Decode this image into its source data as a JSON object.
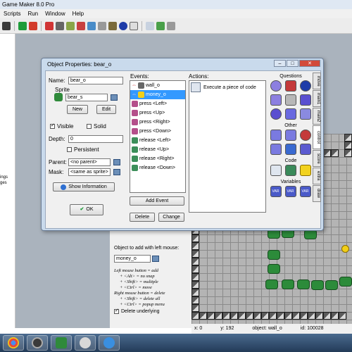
{
  "app": {
    "title": "Game Maker 8.0 Pro",
    "menu": [
      "Scripts",
      "Run",
      "Window",
      "Help"
    ]
  },
  "left_panel": {
    "lines": [
      "ings",
      "ges"
    ]
  },
  "dialog": {
    "title": "Object Properties: bear_o",
    "name_label": "Name:",
    "name_value": "bear_o",
    "sprite_label": "Sprite",
    "sprite_value": "bear_s",
    "new_label": "New",
    "edit_label": "Edit",
    "visible_label": "Visible",
    "solid_label": "Solid",
    "depth_label": "Depth:",
    "depth_value": "0",
    "persistent_label": "Persistent",
    "parent_label": "Parent:",
    "parent_value": "<no parent>",
    "mask_label": "Mask:",
    "mask_value": "<same as sprite>",
    "show_info_label": "Show Information",
    "ok_label": "OK",
    "events_label": "Events:",
    "events": [
      "wall_o",
      "money_o",
      "press <Left>",
      "press <Up>",
      "press <Right>",
      "press <Down>",
      "release <Left>",
      "release <Up>",
      "release <Right>",
      "release <Down>"
    ],
    "add_event_label": "Add Event",
    "delete_label": "Delete",
    "change_label": "Change",
    "actions_label": "Actions:",
    "actions": [
      "Execute a piece of code"
    ],
    "library": {
      "questions_label": "Questions",
      "other_label": "Other",
      "code_label": "Code",
      "variables_label": "Variables",
      "var_label": "VAR"
    },
    "tabs": [
      "move",
      "main1",
      "main2",
      "control",
      "score",
      "extra",
      "draw"
    ]
  },
  "room": {
    "add_label": "Object to add with left mouse:",
    "object_value": "money_o",
    "help_lines": [
      "Left mouse button = add",
      "+ <Alt> = no snap",
      "+ <Shift> = multiple",
      "+ <Ctrl> = move",
      "Right mouse button = delete",
      "+ <Shift> = delete all",
      "+ <Ctrl> = popup menu"
    ],
    "delete_underlying_label": "Delete underlying",
    "status": {
      "x": "x: 0",
      "y": "y: 192",
      "object": "object: wall_o",
      "id": "id: 100028"
    }
  }
}
